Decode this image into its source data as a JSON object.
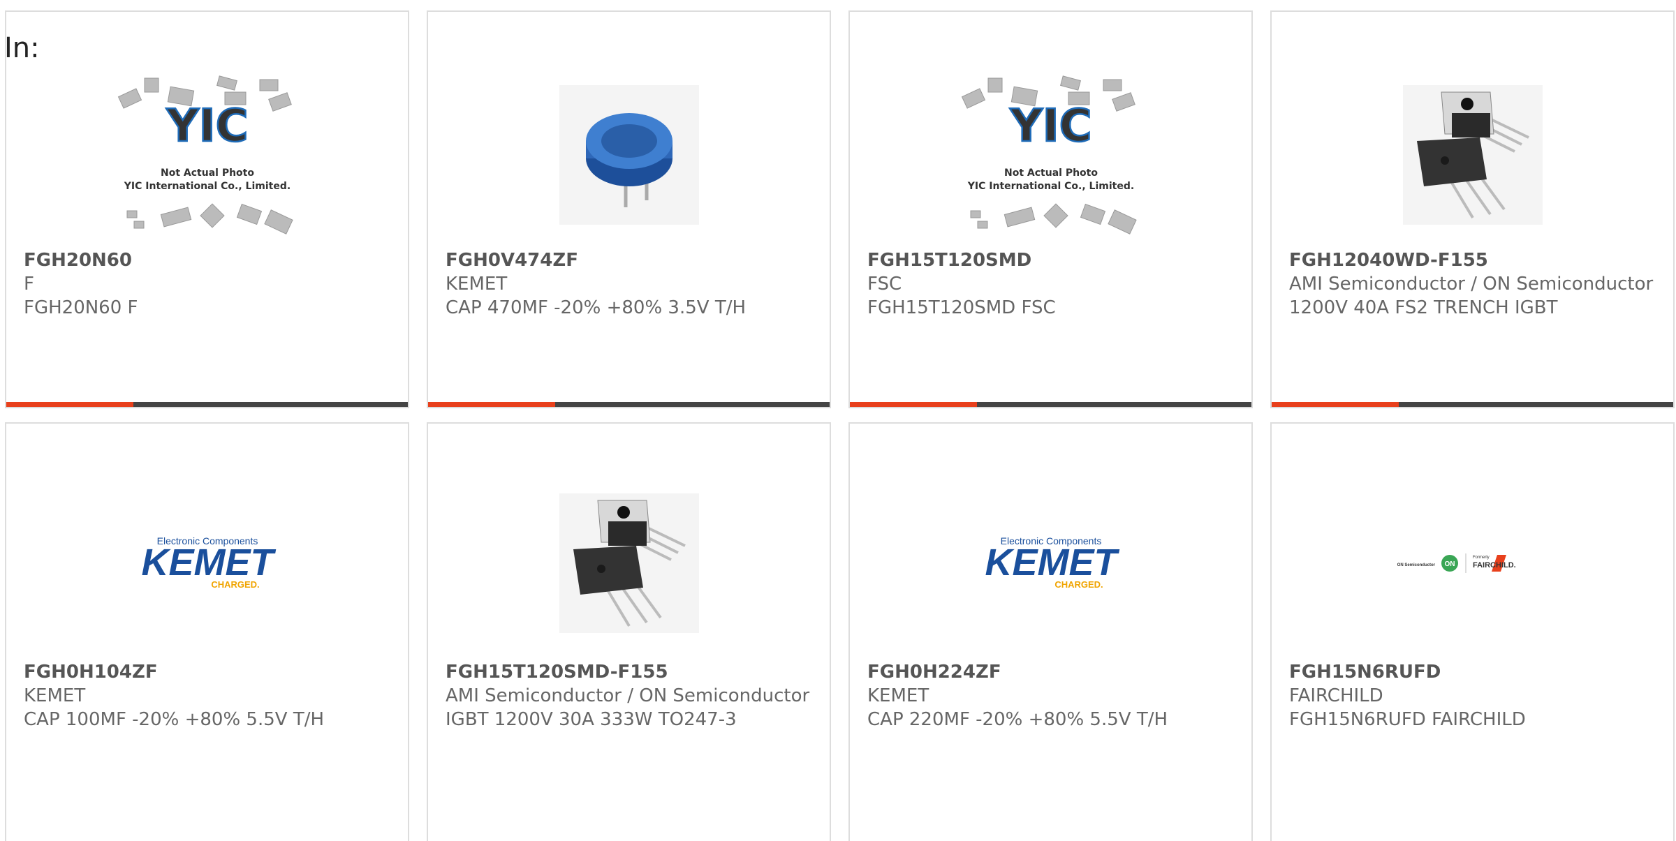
{
  "header": {
    "label": "In:"
  },
  "placeholder": {
    "logo": "YIC",
    "line1": "Not Actual Photo",
    "line2": "YIC International Co., Limited."
  },
  "kemet": {
    "tagline": "Electronic Components",
    "brand": "KEMET",
    "sub": "CHARGED."
  },
  "fairchild": {
    "onsemi": "ON Semiconductor",
    "formerly": "Formerly",
    "brand": "FAIRCHILD."
  },
  "colors": {
    "accent": "#e8401c",
    "bar": "#444444",
    "kemet_blue": "#1a4f9c",
    "kemet_orange": "#f0a400"
  },
  "products": [
    {
      "part": "FGH20N60",
      "mfr": "F",
      "desc": "FGH20N60 F",
      "image": "placeholder"
    },
    {
      "part": "FGH0V474ZF",
      "mfr": "KEMET",
      "desc": "CAP 470MF -20% +80% 3.5V T/H",
      "image": "supercap"
    },
    {
      "part": "FGH15T120SMD",
      "mfr": "FSC",
      "desc": "FGH15T120SMD FSC",
      "image": "placeholder"
    },
    {
      "part": "FGH12040WD-F155",
      "mfr": "AMI Semiconductor / ON Semiconductor",
      "desc": "1200V 40A FS2 TRENCH IGBT",
      "image": "to247"
    },
    {
      "part": "FGH0H104ZF",
      "mfr": "KEMET",
      "desc": "CAP 100MF -20% +80% 5.5V T/H",
      "image": "kemet"
    },
    {
      "part": "FGH15T120SMD-F155",
      "mfr": "AMI Semiconductor / ON Semiconductor",
      "desc": "IGBT 1200V 30A 333W TO247-3",
      "image": "to247"
    },
    {
      "part": "FGH0H224ZF",
      "mfr": "KEMET",
      "desc": "CAP 220MF -20% +80% 5.5V T/H",
      "image": "kemet"
    },
    {
      "part": "FGH15N6RUFD",
      "mfr": "FAIRCHILD",
      "desc": "FGH15N6RUFD FAIRCHILD",
      "image": "fairchild"
    }
  ]
}
